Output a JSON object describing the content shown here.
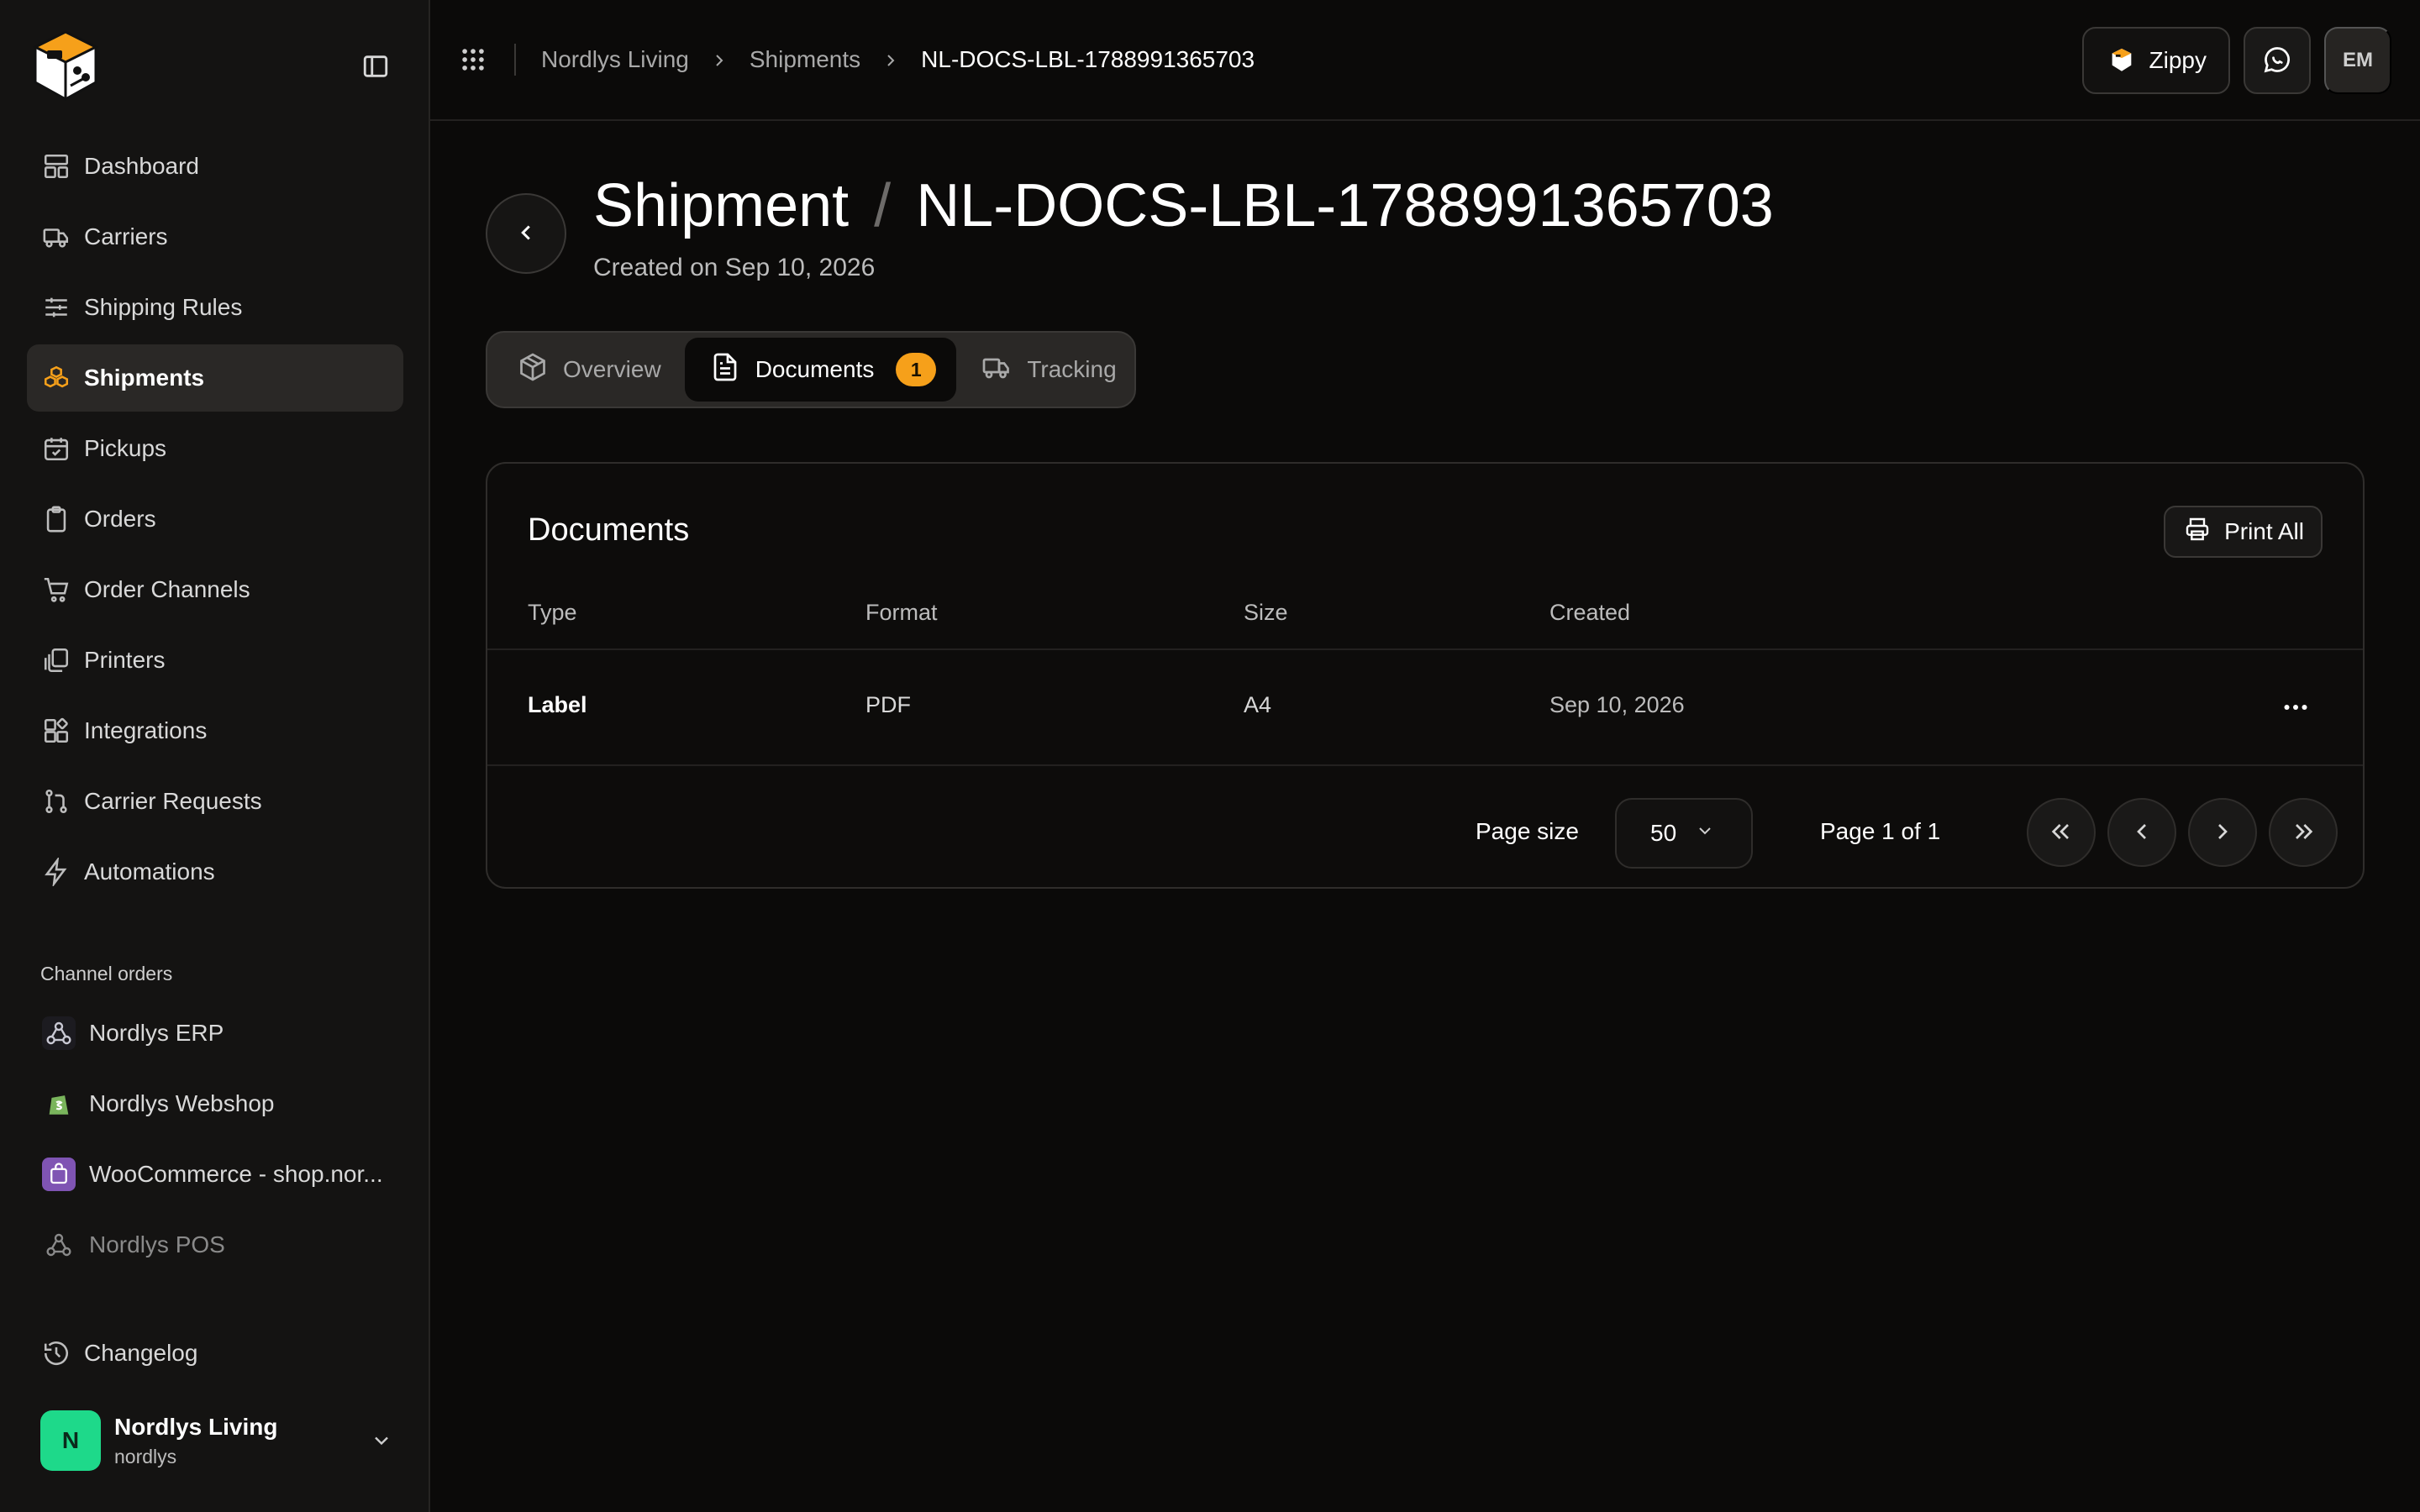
{
  "sidebar": {
    "nav": [
      {
        "label": "Dashboard",
        "icon": "dashboard-icon"
      },
      {
        "label": "Carriers",
        "icon": "truck-icon"
      },
      {
        "label": "Shipping Rules",
        "icon": "sliders-icon"
      },
      {
        "label": "Shipments",
        "icon": "boxes-icon",
        "active": true
      },
      {
        "label": "Pickups",
        "icon": "calendar-check-icon"
      },
      {
        "label": "Orders",
        "icon": "clipboard-icon"
      },
      {
        "label": "Order Channels",
        "icon": "cart-icon"
      },
      {
        "label": "Printers",
        "icon": "copies-icon"
      },
      {
        "label": "Integrations",
        "icon": "blocks-icon"
      },
      {
        "label": "Carrier Requests",
        "icon": "git-pull-icon"
      },
      {
        "label": "Automations",
        "icon": "bolt-icon"
      }
    ],
    "section_label": "Channel orders",
    "channels": [
      {
        "label": "Nordlys ERP",
        "icon": "webhook-icon"
      },
      {
        "label": "Nordlys Webshop",
        "icon": "shopify-icon"
      },
      {
        "label": "WooCommerce - shop.nor...",
        "icon": "woocommerce-icon"
      },
      {
        "label": "Nordlys POS",
        "icon": "webhook-icon",
        "dim": true
      }
    ],
    "changelog": "Changelog",
    "account": {
      "initial": "N",
      "name": "Nordlys Living",
      "sub": "nordlys"
    }
  },
  "topbar": {
    "breadcrumb": [
      "Nordlys Living",
      "Shipments",
      "NL-DOCS-LBL-1788991365703"
    ],
    "zippy_label": "Zippy",
    "user_initials": "EM"
  },
  "page": {
    "title": "Shipment",
    "slash": "/",
    "shipment_id": "NL-DOCS-LBL-1788991365703",
    "created": "Created on Sep 10, 2026"
  },
  "tabs": [
    {
      "label": "Overview"
    },
    {
      "label": "Documents",
      "badge": "1",
      "active": true
    },
    {
      "label": "Tracking"
    }
  ],
  "documents": {
    "title": "Documents",
    "print_all": "Print All",
    "columns": [
      "Type",
      "Format",
      "Size",
      "Created"
    ],
    "rows": [
      {
        "type": "Label",
        "format": "PDF",
        "size": "A4",
        "created": "Sep 10, 2026"
      }
    ],
    "pagination": {
      "page_size_label": "Page size",
      "page_size": "50",
      "page_info": "Page 1 of 1"
    }
  },
  "colors": {
    "accent": "#f6a01a",
    "avatar": "#1ed98a",
    "background": "#0b0a09",
    "sidebar": "#141312"
  }
}
